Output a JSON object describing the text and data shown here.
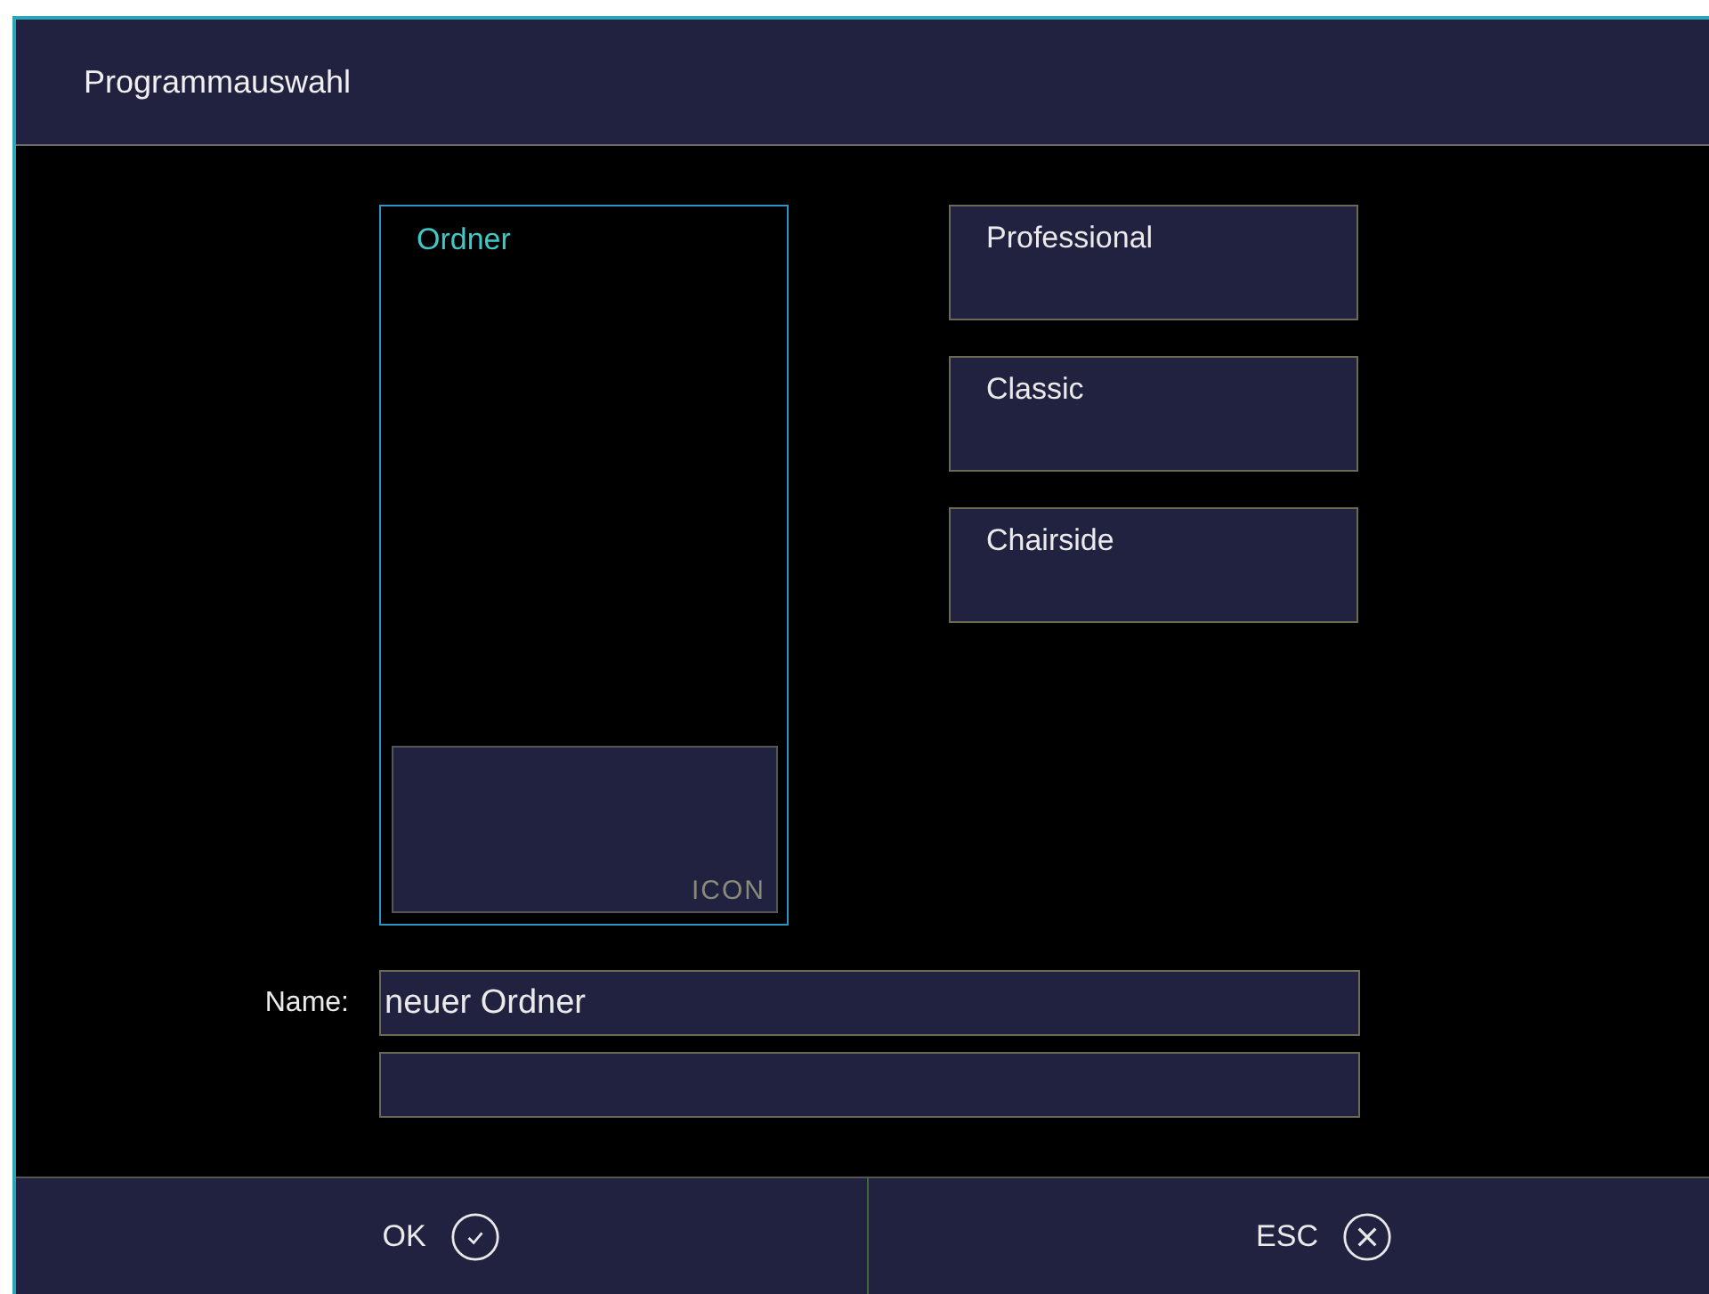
{
  "window": {
    "title": "Programmauswahl"
  },
  "folder": {
    "label": "Ordner",
    "selected": true,
    "icon_label": "ICON"
  },
  "programs": [
    {
      "label": "Professional",
      "selected": false
    },
    {
      "label": "Classic",
      "selected": false
    },
    {
      "label": "Chairside",
      "selected": false
    }
  ],
  "name_field": {
    "label": "Name:",
    "value": "neuer Ordner"
  },
  "buttons": [
    {
      "label": "OK",
      "kind": "ok"
    },
    {
      "label": "ESC",
      "kind": "esc"
    }
  ]
}
